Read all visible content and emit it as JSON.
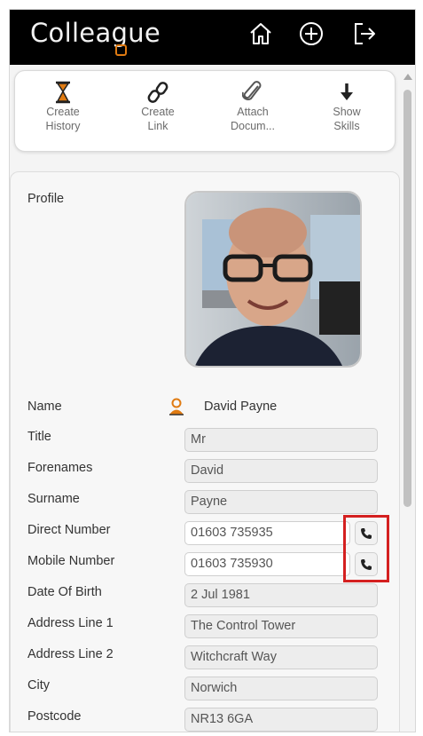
{
  "app": {
    "logo": "Colleague"
  },
  "header_icons": [
    "home-icon",
    "plus-circle-icon",
    "logout-icon"
  ],
  "toolbar": [
    {
      "label": "Create History",
      "icon": "hourglass-icon"
    },
    {
      "label": "Create Link",
      "icon": "link-icon"
    },
    {
      "label": "Attach Docum...",
      "icon": "paperclip-icon"
    },
    {
      "label": "Show Skills",
      "icon": "arrow-down-icon"
    }
  ],
  "profile": {
    "profile_label": "Profile",
    "name_label": "Name",
    "name_value": "David Payne",
    "fields": [
      {
        "label": "Title",
        "value": "Mr"
      },
      {
        "label": "Forenames",
        "value": "David"
      },
      {
        "label": "Surname",
        "value": "Payne"
      },
      {
        "label": "Direct Number",
        "value": "01603 735935"
      },
      {
        "label": "Mobile Number",
        "value": "01603 735930"
      },
      {
        "label": "Date Of Birth",
        "value": "2 Jul 1981"
      },
      {
        "label": "Address Line 1",
        "value": "The Control Tower"
      },
      {
        "label": "Address Line 2",
        "value": "Witchcraft Way"
      },
      {
        "label": "City",
        "value": "Norwich"
      },
      {
        "label": "Postcode",
        "value": "NR13 6GA"
      }
    ]
  },
  "colors": {
    "accent": "#e07b12",
    "highlight": "#d42020",
    "header_bg": "#000000"
  }
}
